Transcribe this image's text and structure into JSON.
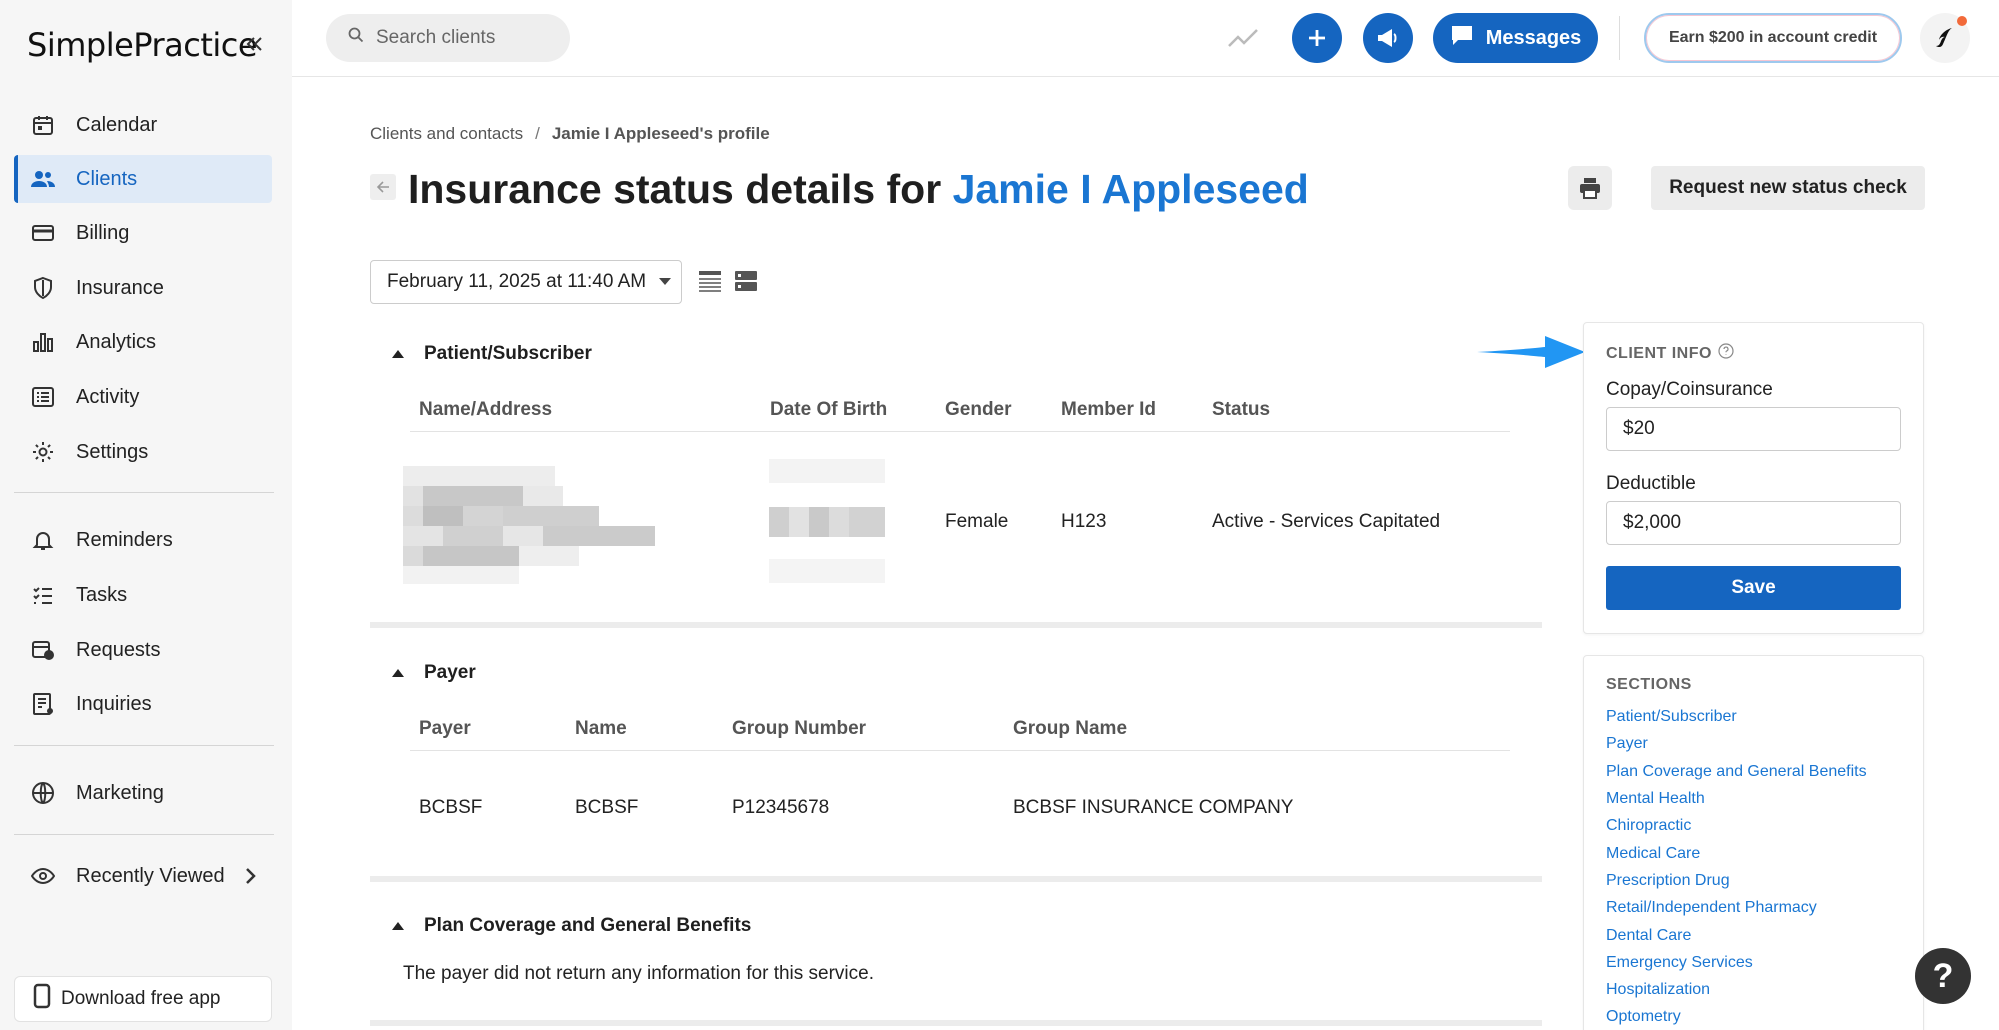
{
  "app": {
    "logo_text": "SimplePractice"
  },
  "sidebar": {
    "items": [
      {
        "label": "Calendar",
        "icon": "calendar-icon"
      },
      {
        "label": "Clients",
        "icon": "users-icon",
        "active": true
      },
      {
        "label": "Billing",
        "icon": "credit-card-icon"
      },
      {
        "label": "Insurance",
        "icon": "shield-icon"
      },
      {
        "label": "Analytics",
        "icon": "bar-chart-icon"
      },
      {
        "label": "Activity",
        "icon": "list-icon"
      },
      {
        "label": "Settings",
        "icon": "gear-icon"
      },
      {
        "label": "Reminders",
        "icon": "bell-icon"
      },
      {
        "label": "Tasks",
        "icon": "checklist-icon"
      },
      {
        "label": "Requests",
        "icon": "calendar-clock-icon"
      },
      {
        "label": "Inquiries",
        "icon": "form-icon"
      },
      {
        "label": "Marketing",
        "icon": "globe-icon"
      },
      {
        "label": "Recently Viewed",
        "icon": "eye-icon"
      }
    ],
    "download_label": "Download free app"
  },
  "topbar": {
    "search_placeholder": "Search clients",
    "messages_label": "Messages",
    "earn_label": "Earn $200 in account credit"
  },
  "breadcrumb": {
    "parent": "Clients and contacts",
    "separator": "/",
    "current": "Jamie I Appleseed's profile"
  },
  "page": {
    "title_prefix": "Insurance status details for",
    "client_name": "Jamie I Appleseed",
    "request_button": "Request new status check",
    "date_selected": "February 11, 2025 at 11:40 AM"
  },
  "patient_section": {
    "title": "Patient/Subscriber",
    "headers": [
      "Name/Address",
      "Date Of Birth",
      "Gender",
      "Member Id",
      "Status"
    ],
    "row": {
      "gender": "Female",
      "member_id": "H123",
      "status": "Active - Services Capitated"
    }
  },
  "payer_section": {
    "title": "Payer",
    "headers": [
      "Payer",
      "Name",
      "Group Number",
      "Group Name"
    ],
    "row": {
      "payer": "BCBSF",
      "name": "BCBSF",
      "group_number": "P12345678",
      "group_name": "BCBSF INSURANCE COMPANY"
    }
  },
  "plan_section": {
    "title": "Plan Coverage and General Benefits",
    "message": "The payer did not return any information for this service."
  },
  "client_info": {
    "title": "CLIENT INFO",
    "copay_label": "Copay/Coinsurance",
    "copay_value": "$20",
    "deductible_label": "Deductible",
    "deductible_value": "$2,000",
    "save_label": "Save"
  },
  "sections_panel": {
    "title": "SECTIONS",
    "links": [
      "Patient/Subscriber",
      "Payer",
      "Plan Coverage and General Benefits",
      "Mental Health",
      "Chiropractic",
      "Medical Care",
      "Prescription Drug",
      "Retail/Independent Pharmacy",
      "Dental Care",
      "Emergency Services",
      "Hospitalization",
      "Optometry"
    ]
  },
  "help_label": "?",
  "colors": {
    "brand": "#1565c0",
    "link": "#1a76d2",
    "arrow": "#2196f3"
  }
}
